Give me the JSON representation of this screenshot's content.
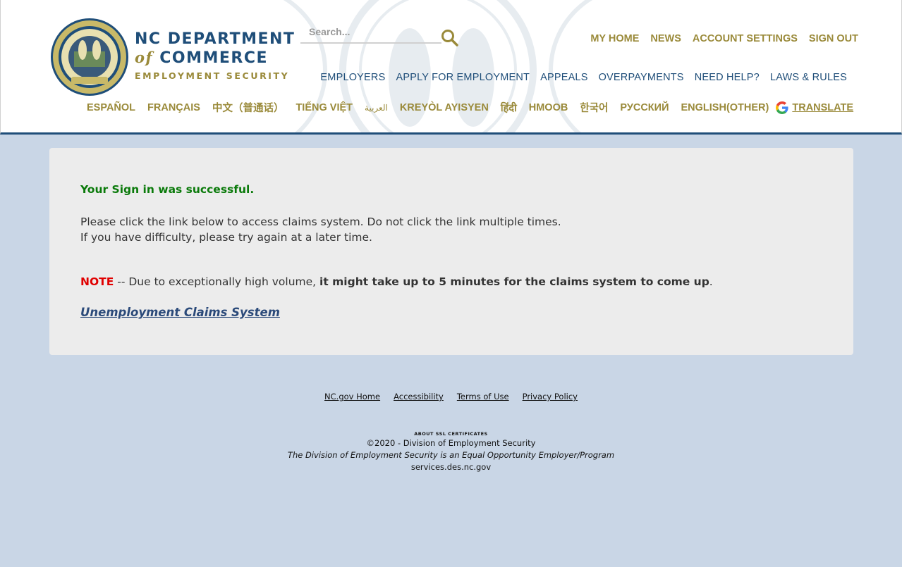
{
  "header": {
    "logo": {
      "line1": "NC DEPARTMENT",
      "line2_of": "of",
      "line2_rest": "COMMERCE",
      "line3": "EMPLOYMENT SECURITY"
    },
    "search": {
      "placeholder": "Search..."
    },
    "top_nav": [
      "MY HOME",
      "NEWS",
      "ACCOUNT SETTINGS",
      "SIGN OUT"
    ],
    "main_nav": [
      "EMPLOYERS",
      "APPLY FOR EMPLOYMENT",
      "APPEALS",
      "OVERPAYMENTS",
      "NEED HELP?",
      "LAWS & RULES"
    ],
    "languages": [
      "ESPAÑOL",
      "FRANÇAIS",
      "中文（普通话）",
      "TIẾNG VIỆT",
      "العربية",
      "KREYÒL AYISYEN",
      "हिंदी",
      "HMOOB",
      "한국어",
      "РУССКИЙ",
      "ENGLISH(OTHER)"
    ],
    "translate_label": "TRANSLATE"
  },
  "content": {
    "success": "Your Sign in was successful.",
    "message_line1": "Please click the link below to access claims system. Do not click the link multiple times.",
    "message_line2": "If you have difficulty, please try again at a later time.",
    "note_label": "NOTE",
    "note_text": " -- Due to exceptionally high volume, ",
    "note_bold": "it might take up to 5 minutes for the claims system to come up",
    "note_end": ".",
    "link": "Unemployment Claims System"
  },
  "footer": {
    "links": [
      "NC.gov Home",
      "Accessibility",
      "Terms of Use",
      "Privacy Policy"
    ],
    "ssl": "ABOUT SSL CERTIFICATES",
    "copyright": "©2020 - Division of Employment Security",
    "eeo": "The Division of Employment Security is an Equal Opportunity Employer/Program",
    "domain": "services.des.nc.gov"
  },
  "colors": {
    "navy": "#1f4e79",
    "gold": "#9a8a3a",
    "success_green": "#0a7a0a",
    "note_red": "#e00000",
    "page_bg": "#c9d6e6",
    "panel_bg": "#ececec"
  }
}
